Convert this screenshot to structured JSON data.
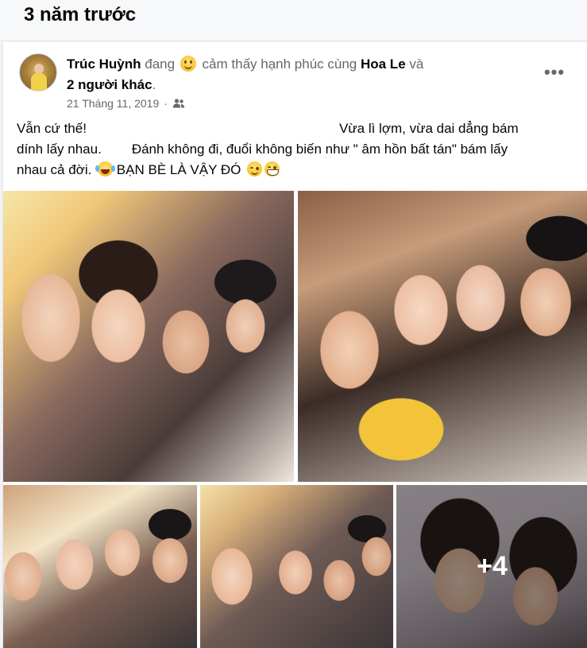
{
  "memory": {
    "title": "3 năm trước"
  },
  "post": {
    "author": "Trúc Huỳnh",
    "feeling_prefix": "đang",
    "feeling_text": "cảm thấy hạnh phúc cùng",
    "tagged_person": "Hoa Le",
    "and_word": "và",
    "others": "2 người khác",
    "period": ".",
    "date": "21 Tháng 11, 2019",
    "dot": "·",
    "audience_icon": "friends-icon",
    "more_icon": "more-options-icon",
    "text": {
      "line1_a": "Vẫn cứ thế!",
      "line1_b": "Vừa lì lợm, vừa dai dẳng bám",
      "line2_a": "dính lấy nhau.",
      "line2_b": "Đánh không đi, đuổi không biến như \" âm hồn bất tán\" bám lấy",
      "line3": "nhau cả đời.",
      "line3_b": "BẠN BÈ LÀ VẬY ĐÓ"
    },
    "photos": {
      "more_count": "+4"
    }
  },
  "colors": {
    "text_primary": "#050505",
    "text_secondary": "#65676b",
    "card_bg": "#ffffff",
    "page_bg": "#f0f2f5"
  }
}
